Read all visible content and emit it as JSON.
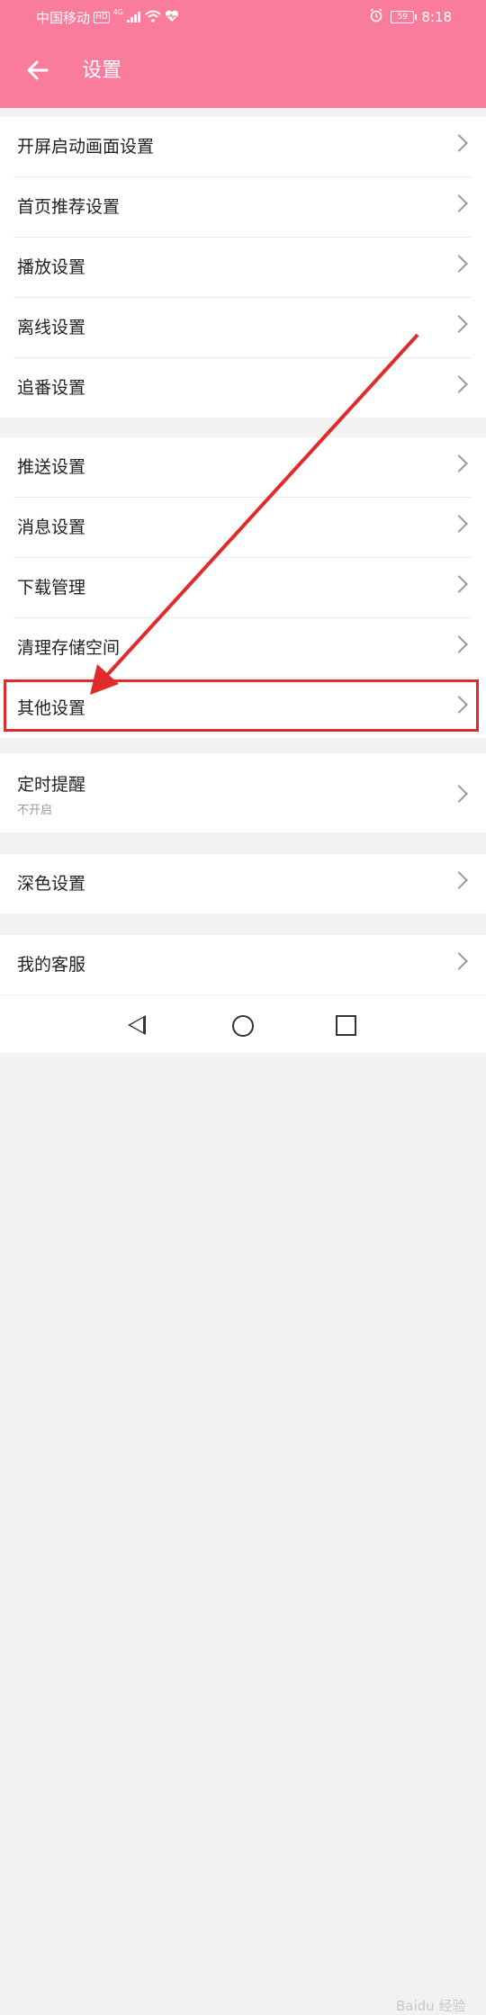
{
  "status_bar": {
    "carrier": "中国移动",
    "hd": "HD",
    "network": "4G",
    "battery": "59",
    "time": "8:18"
  },
  "header": {
    "back_icon": "arrow-left-icon",
    "title": "设置"
  },
  "groups": [
    {
      "items": [
        {
          "label": "开屏启动画面设置"
        },
        {
          "label": "首页推荐设置"
        },
        {
          "label": "播放设置"
        },
        {
          "label": "离线设置"
        },
        {
          "label": "追番设置"
        }
      ]
    },
    {
      "items": [
        {
          "label": "推送设置"
        },
        {
          "label": "消息设置"
        },
        {
          "label": "下载管理"
        },
        {
          "label": "清理存储空间"
        },
        {
          "label": "其他设置"
        }
      ]
    },
    {
      "items": [
        {
          "label": "定时提醒",
          "sublabel": "不开启"
        }
      ]
    },
    {
      "items": [
        {
          "label": "深色设置"
        }
      ]
    },
    {
      "items": [
        {
          "label": "我的客服"
        }
      ]
    }
  ],
  "colors": {
    "accent": "#f97c9d",
    "annotation": "#e12b2b"
  },
  "watermark": "Baidu 经验"
}
